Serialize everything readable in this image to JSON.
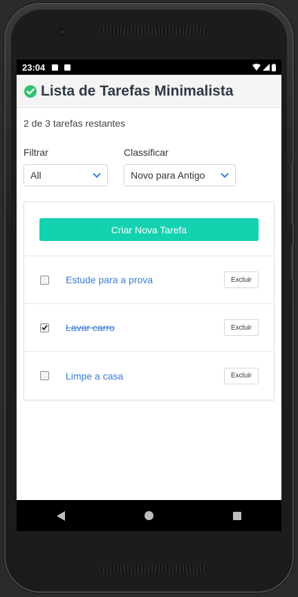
{
  "statusbar": {
    "time": "23:04"
  },
  "app": {
    "title": "Lista de Tarefas Minimalista"
  },
  "summary": {
    "remaining": "2 de 3 tarefas restantes"
  },
  "filters": {
    "filter_label": "Filtrar",
    "filter_value": "All",
    "sort_label": "Classificar",
    "sort_value": "Novo para Antigo"
  },
  "create_button": "Criar Nova Tarefa",
  "tasks": [
    {
      "text": "Estude para a prova",
      "done": false,
      "delete_label": "Excluir"
    },
    {
      "text": "Lavar carro",
      "done": true,
      "delete_label": "Excluir"
    },
    {
      "text": "Limpe a casa",
      "done": false,
      "delete_label": "Excluir"
    }
  ],
  "colors": {
    "accent": "#14d1b0",
    "link": "#3a7bd5",
    "check_green": "#2ec46f"
  }
}
